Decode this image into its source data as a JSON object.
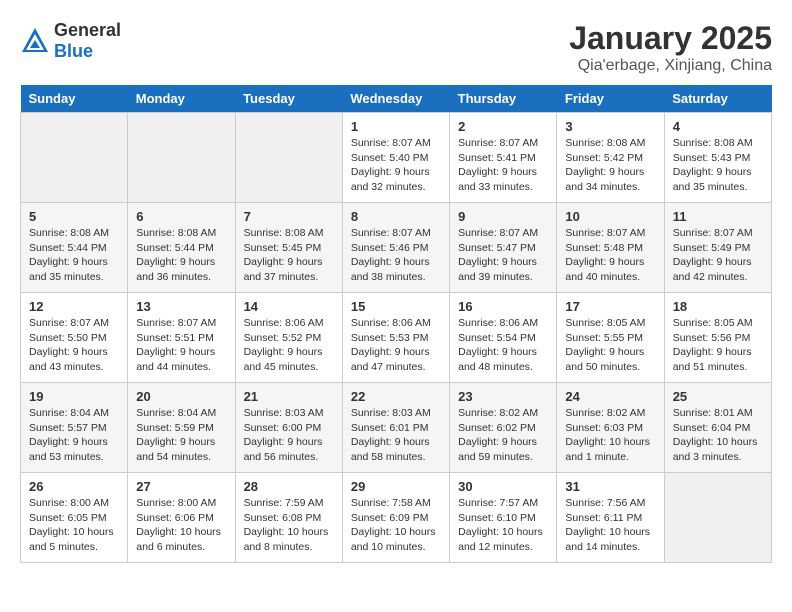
{
  "header": {
    "logo": {
      "general": "General",
      "blue": "Blue"
    },
    "month": "January 2025",
    "location": "Qia'erbage, Xinjiang, China"
  },
  "weekdays": [
    "Sunday",
    "Monday",
    "Tuesday",
    "Wednesday",
    "Thursday",
    "Friday",
    "Saturday"
  ],
  "weeks": [
    [
      {
        "day": "",
        "info": ""
      },
      {
        "day": "",
        "info": ""
      },
      {
        "day": "",
        "info": ""
      },
      {
        "day": "1",
        "info": "Sunrise: 8:07 AM\nSunset: 5:40 PM\nDaylight: 9 hours and 32 minutes."
      },
      {
        "day": "2",
        "info": "Sunrise: 8:07 AM\nSunset: 5:41 PM\nDaylight: 9 hours and 33 minutes."
      },
      {
        "day": "3",
        "info": "Sunrise: 8:08 AM\nSunset: 5:42 PM\nDaylight: 9 hours and 34 minutes."
      },
      {
        "day": "4",
        "info": "Sunrise: 8:08 AM\nSunset: 5:43 PM\nDaylight: 9 hours and 35 minutes."
      }
    ],
    [
      {
        "day": "5",
        "info": "Sunrise: 8:08 AM\nSunset: 5:44 PM\nDaylight: 9 hours and 35 minutes."
      },
      {
        "day": "6",
        "info": "Sunrise: 8:08 AM\nSunset: 5:44 PM\nDaylight: 9 hours and 36 minutes."
      },
      {
        "day": "7",
        "info": "Sunrise: 8:08 AM\nSunset: 5:45 PM\nDaylight: 9 hours and 37 minutes."
      },
      {
        "day": "8",
        "info": "Sunrise: 8:07 AM\nSunset: 5:46 PM\nDaylight: 9 hours and 38 minutes."
      },
      {
        "day": "9",
        "info": "Sunrise: 8:07 AM\nSunset: 5:47 PM\nDaylight: 9 hours and 39 minutes."
      },
      {
        "day": "10",
        "info": "Sunrise: 8:07 AM\nSunset: 5:48 PM\nDaylight: 9 hours and 40 minutes."
      },
      {
        "day": "11",
        "info": "Sunrise: 8:07 AM\nSunset: 5:49 PM\nDaylight: 9 hours and 42 minutes."
      }
    ],
    [
      {
        "day": "12",
        "info": "Sunrise: 8:07 AM\nSunset: 5:50 PM\nDaylight: 9 hours and 43 minutes."
      },
      {
        "day": "13",
        "info": "Sunrise: 8:07 AM\nSunset: 5:51 PM\nDaylight: 9 hours and 44 minutes."
      },
      {
        "day": "14",
        "info": "Sunrise: 8:06 AM\nSunset: 5:52 PM\nDaylight: 9 hours and 45 minutes."
      },
      {
        "day": "15",
        "info": "Sunrise: 8:06 AM\nSunset: 5:53 PM\nDaylight: 9 hours and 47 minutes."
      },
      {
        "day": "16",
        "info": "Sunrise: 8:06 AM\nSunset: 5:54 PM\nDaylight: 9 hours and 48 minutes."
      },
      {
        "day": "17",
        "info": "Sunrise: 8:05 AM\nSunset: 5:55 PM\nDaylight: 9 hours and 50 minutes."
      },
      {
        "day": "18",
        "info": "Sunrise: 8:05 AM\nSunset: 5:56 PM\nDaylight: 9 hours and 51 minutes."
      }
    ],
    [
      {
        "day": "19",
        "info": "Sunrise: 8:04 AM\nSunset: 5:57 PM\nDaylight: 9 hours and 53 minutes."
      },
      {
        "day": "20",
        "info": "Sunrise: 8:04 AM\nSunset: 5:59 PM\nDaylight: 9 hours and 54 minutes."
      },
      {
        "day": "21",
        "info": "Sunrise: 8:03 AM\nSunset: 6:00 PM\nDaylight: 9 hours and 56 minutes."
      },
      {
        "day": "22",
        "info": "Sunrise: 8:03 AM\nSunset: 6:01 PM\nDaylight: 9 hours and 58 minutes."
      },
      {
        "day": "23",
        "info": "Sunrise: 8:02 AM\nSunset: 6:02 PM\nDaylight: 9 hours and 59 minutes."
      },
      {
        "day": "24",
        "info": "Sunrise: 8:02 AM\nSunset: 6:03 PM\nDaylight: 10 hours and 1 minute."
      },
      {
        "day": "25",
        "info": "Sunrise: 8:01 AM\nSunset: 6:04 PM\nDaylight: 10 hours and 3 minutes."
      }
    ],
    [
      {
        "day": "26",
        "info": "Sunrise: 8:00 AM\nSunset: 6:05 PM\nDaylight: 10 hours and 5 minutes."
      },
      {
        "day": "27",
        "info": "Sunrise: 8:00 AM\nSunset: 6:06 PM\nDaylight: 10 hours and 6 minutes."
      },
      {
        "day": "28",
        "info": "Sunrise: 7:59 AM\nSunset: 6:08 PM\nDaylight: 10 hours and 8 minutes."
      },
      {
        "day": "29",
        "info": "Sunrise: 7:58 AM\nSunset: 6:09 PM\nDaylight: 10 hours and 10 minutes."
      },
      {
        "day": "30",
        "info": "Sunrise: 7:57 AM\nSunset: 6:10 PM\nDaylight: 10 hours and 12 minutes."
      },
      {
        "day": "31",
        "info": "Sunrise: 7:56 AM\nSunset: 6:11 PM\nDaylight: 10 hours and 14 minutes."
      },
      {
        "day": "",
        "info": ""
      }
    ]
  ]
}
